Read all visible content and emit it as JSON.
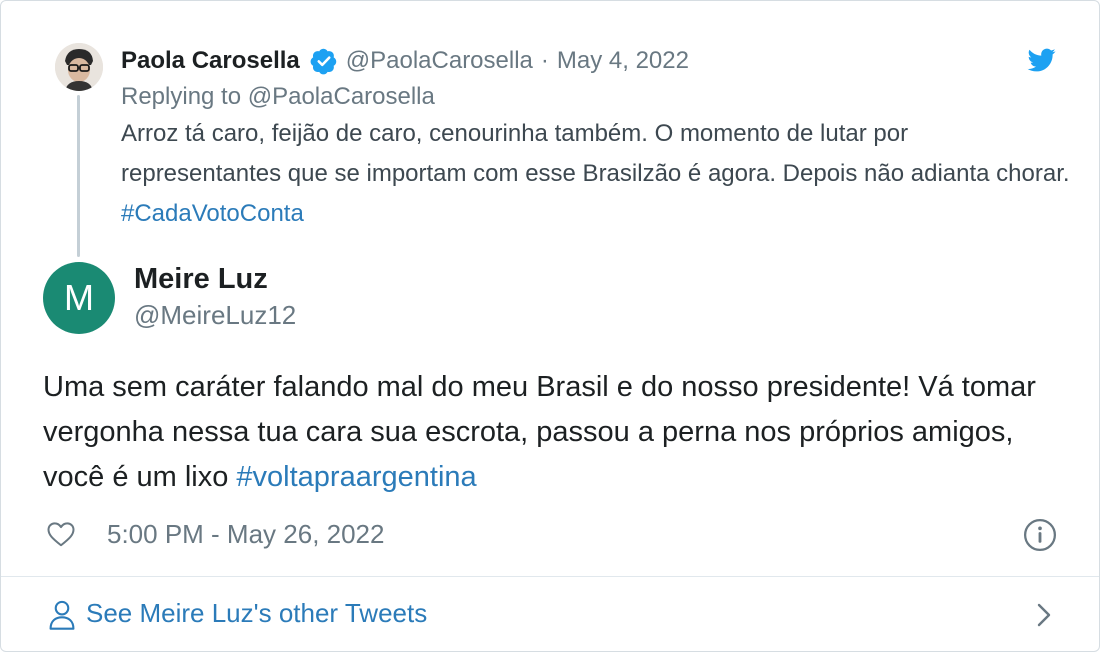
{
  "parent_tweet": {
    "author_name": "Paola Carosella",
    "handle": "@PaolaCarosella",
    "separator": "·",
    "date": "May 4, 2022",
    "replying_to": "Replying to @PaolaCarosella",
    "text": "Arroz tá caro, feijão de caro, cenourinha também. O momento de lutar por representantes que se importam com esse Brasilzão é agora. Depois não adianta chorar. ",
    "hashtag": "#CadaVotoConta"
  },
  "main_tweet": {
    "avatar_initial": "M",
    "avatar_color": "#1a8a73",
    "author_name": "Meire Luz",
    "handle": "@MeireLuz12",
    "text": "Uma sem caráter falando mal do meu Brasil e do nosso presidente! Vá tomar vergonha nessa tua cara sua escrota, passou a perna nos próprios amigos, você é um lixo ",
    "hashtag": "#voltapraargentina",
    "timestamp": "5:00 PM - May 26, 2022"
  },
  "footer": {
    "see_more_label": "See Meire Luz's other Tweets"
  },
  "icons": {
    "brand": "twitter-bird-icon",
    "verified": "verified-badge-icon",
    "like": "heart-icon",
    "info": "info-icon",
    "person": "person-icon",
    "chevron": "chevron-right-icon"
  },
  "colors": {
    "link": "#2b7bb9",
    "twitter_blue": "#1da1f2",
    "secondary_text": "#697882",
    "thread_line": "#c4cfd6"
  }
}
